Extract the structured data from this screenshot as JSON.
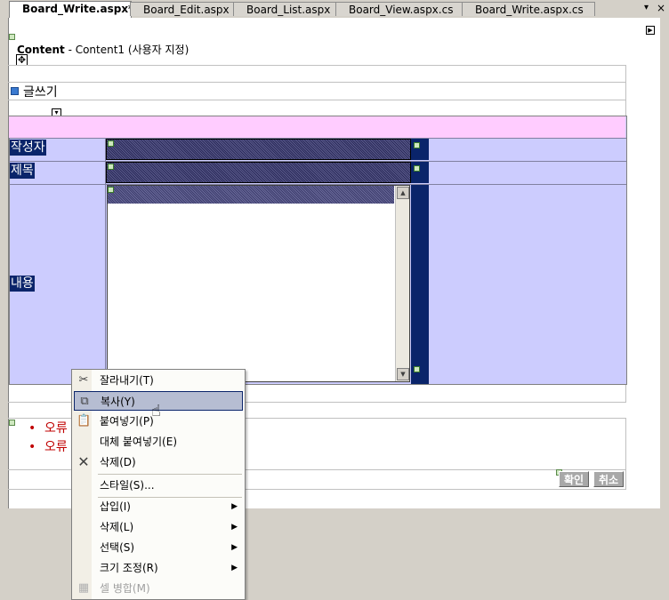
{
  "tabs": [
    {
      "label": "Board_Write.aspx*",
      "active": true
    },
    {
      "label": "Board_Edit.aspx",
      "active": false
    },
    {
      "label": "Board_List.aspx",
      "active": false
    },
    {
      "label": "Board_View.aspx.cs",
      "active": false
    },
    {
      "label": "Board_Write.aspx.cs",
      "active": false
    }
  ],
  "window_controls": {
    "dropdown": "▾",
    "close": "×"
  },
  "content": {
    "name": "Content",
    "suffix": " - Content1 (사용자 지정)"
  },
  "page": {
    "title": "글쓰기",
    "fields": {
      "writer": "작성자",
      "subject": "제목",
      "body": "내용"
    },
    "errors": [
      "오류",
      "오류"
    ],
    "ok_button": "확인",
    "cancel_button": "취소"
  },
  "context_menu": {
    "items": [
      {
        "label": "잘라내기(T)",
        "icon": "cut-icon"
      },
      {
        "label": "복사(Y)",
        "icon": "copy-icon",
        "highlighted": true
      },
      {
        "label": "붙여넣기(P)",
        "icon": "paste-icon"
      },
      {
        "label": "대체 붙여넣기(E)",
        "icon": ""
      },
      {
        "label": "삭제(D)",
        "icon": "delete-icon"
      },
      {
        "label": "스타일(S)...",
        "icon": ""
      },
      {
        "label": "삽입(I)",
        "icon": "",
        "submenu": true
      },
      {
        "label": "삭제(L)",
        "icon": "",
        "submenu": true
      },
      {
        "label": "선택(S)",
        "icon": "",
        "submenu": true
      },
      {
        "label": "크기 조정(R)",
        "icon": "",
        "submenu": true
      },
      {
        "label": "셀 병합(M)",
        "icon": "merge-cells-icon",
        "disabled": true
      }
    ]
  },
  "colors": {
    "surface": "#ffffff",
    "form_bg": "#ccccfe",
    "header_row": "#ffccff",
    "selection": "#0a246a",
    "error_text": "#c00000",
    "menu_highlight": "#b6bdd2"
  }
}
